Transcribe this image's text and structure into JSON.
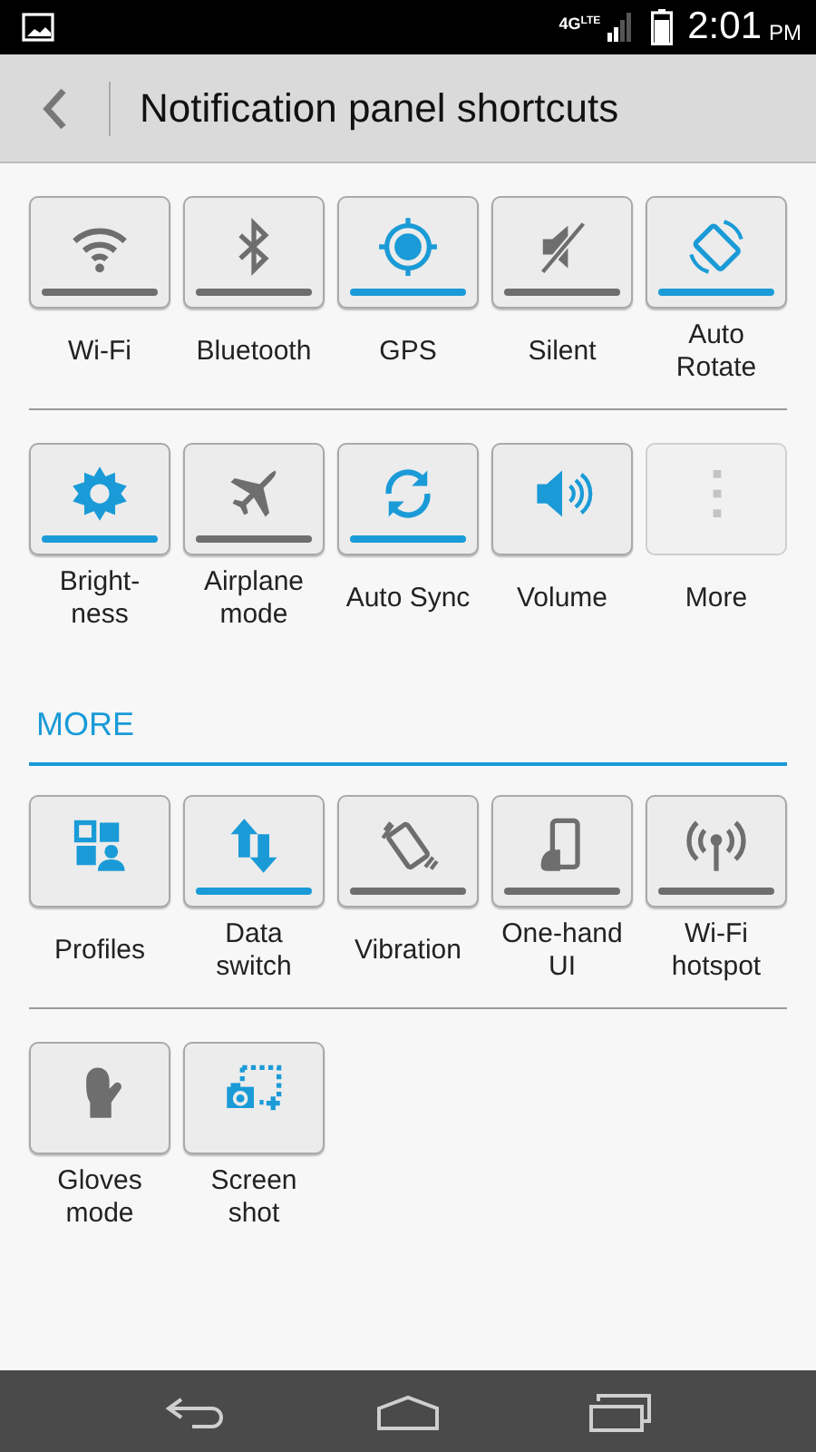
{
  "status_bar": {
    "network": "4G",
    "network_sub": "LTE",
    "time": "2:01",
    "ampm": "PM"
  },
  "title_bar": {
    "title": "Notification panel shortcuts"
  },
  "sections": [
    {
      "rows": [
        [
          {
            "label": "Wi-Fi",
            "kind": "toggle",
            "active": false,
            "disabled": false
          },
          {
            "label": "Bluetooth",
            "kind": "toggle",
            "active": false,
            "disabled": false
          },
          {
            "label": "GPS",
            "kind": "toggle",
            "active": true,
            "disabled": false
          },
          {
            "label": "Silent",
            "kind": "toggle",
            "active": false,
            "disabled": false
          },
          {
            "label": "Auto\nRotate",
            "kind": "toggle",
            "active": true,
            "disabled": false
          }
        ],
        [
          {
            "label": "Bright-\nness",
            "kind": "toggle",
            "active": true,
            "disabled": false
          },
          {
            "label": "Airplane\nmode",
            "kind": "toggle",
            "active": false,
            "disabled": false
          },
          {
            "label": "Auto Sync",
            "kind": "toggle",
            "active": true,
            "disabled": false
          },
          {
            "label": "Volume",
            "kind": "button",
            "active": true,
            "disabled": false
          },
          {
            "label": "More",
            "kind": "button",
            "active": false,
            "disabled": true
          }
        ]
      ]
    },
    {
      "heading": "MORE",
      "rows": [
        [
          {
            "label": "Profiles",
            "kind": "button",
            "active": true,
            "disabled": false
          },
          {
            "label": "Data\nswitch",
            "kind": "toggle",
            "active": true,
            "disabled": false
          },
          {
            "label": "Vibration",
            "kind": "toggle",
            "active": false,
            "disabled": false
          },
          {
            "label": "One-hand\nUI",
            "kind": "toggle",
            "active": false,
            "disabled": false
          },
          {
            "label": "Wi-Fi\nhotspot",
            "kind": "toggle",
            "active": false,
            "disabled": false
          }
        ],
        [
          {
            "label": "Gloves\nmode",
            "kind": "button",
            "active": false,
            "disabled": false
          },
          {
            "label": "Screen\nshot",
            "kind": "button",
            "active": true,
            "disabled": false
          }
        ]
      ]
    }
  ]
}
